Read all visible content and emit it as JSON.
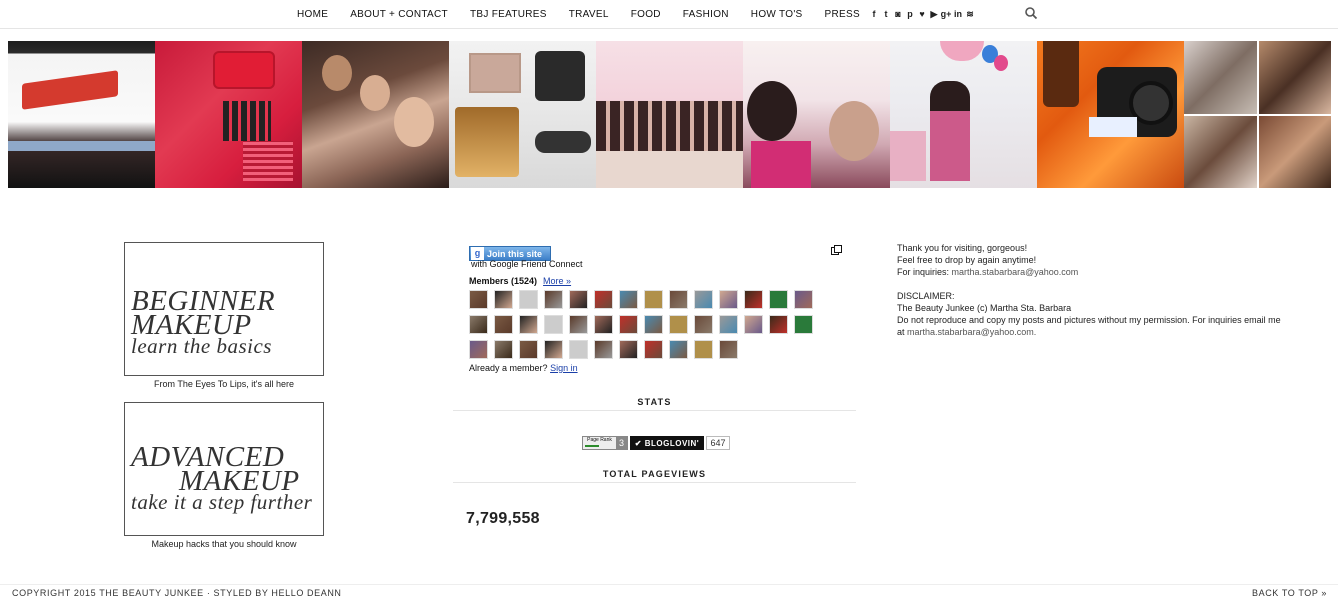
{
  "nav": {
    "items": [
      "HOME",
      "ABOUT + CONTACT",
      "TBJ FEATURES",
      "TRAVEL",
      "FOOD",
      "FASHION",
      "HOW TO'S",
      "PRESS"
    ],
    "social": [
      "f",
      "t",
      "ig",
      "p",
      "♥",
      "yt",
      "g+",
      "in",
      "rss"
    ]
  },
  "promos": [
    {
      "line1": "BEGINNER",
      "line2": "MAKEUP",
      "line3": "learn the basics",
      "caption": "From The Eyes To Lips, it's all here"
    },
    {
      "line1": "ADVANCED",
      "line2": "MAKEUP",
      "line3": "take it a step further",
      "caption": "Makeup hacks that you should know"
    }
  ],
  "gfc": {
    "join_label": "Join this site",
    "subtitle": "with Google Friend Connect",
    "members_label": "Members (1524)",
    "more_label": "More »",
    "already_label": "Already a member?",
    "signin_label": "Sign in"
  },
  "stats": {
    "title": "STATS",
    "pagerank_label": "Page Rank",
    "pagerank_value": "3",
    "bloglovin_label": "✔ BLOGLOVIN'",
    "bloglovin_count": "647"
  },
  "pageviews": {
    "title": "TOTAL PAGEVIEWS",
    "value": "7,799,558"
  },
  "about": {
    "line1": "Thank you for visiting, gorgeous!",
    "line2": "Feel free to drop by again anytime!",
    "inquiries_label": "For inquiries:",
    "email": "martha.stabarbara@yahoo.com",
    "disclaimer_title": "DISCLAIMER:",
    "disclaimer_line1": "The Beauty Junkee (c) Martha Sta. Barbara",
    "disclaimer_line2": "Do not reproduce and copy my posts and pictures without my permission. For inquiries email me",
    "disclaimer_at": "at",
    "disclaimer_email": "martha.stabarbara@yahoo.com."
  },
  "footer": {
    "copyright": "COPYRIGHT 2015 THE BEAUTY JUNKEE · STYLED BY HELLO DEANN",
    "back_to_top": "BACK TO TOP »"
  }
}
